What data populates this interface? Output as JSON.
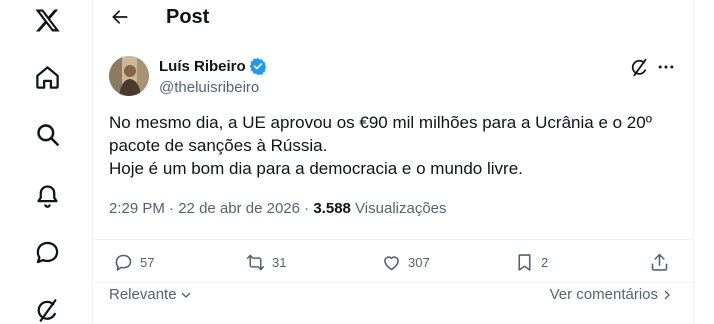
{
  "header": {
    "title": "Post"
  },
  "sidebar": {
    "items": [
      {
        "icon": "x-logo-icon"
      },
      {
        "icon": "home-icon"
      },
      {
        "icon": "search-icon"
      },
      {
        "icon": "notifications-bell-icon"
      },
      {
        "icon": "messages-icon"
      },
      {
        "icon": "grok-icon"
      }
    ]
  },
  "tweet": {
    "author_name": "Luís Ribeiro",
    "author_handle": "@theluisribeiro",
    "verified": true,
    "text_lines": [
      "No mesmo dia, a UE aprovou os €90 mil milhões para a Ucrânia e o 20º",
      "pacote de sanções à Rússia.",
      "Hoje é um bom dia para a democracia e o mundo livre."
    ],
    "time": "2:29 PM",
    "separator": "·",
    "date": "22 de abr de 2026",
    "views": "3.588",
    "views_label": "Visualizações",
    "stats": {
      "replies": "57",
      "reposts": "31",
      "likes": "307",
      "bookmarks": "2"
    }
  },
  "replies": {
    "sort_label": "Relevante",
    "see_comments_label": "Ver comentários"
  },
  "colors": {
    "text_primary": "#0f1419",
    "text_secondary": "#536471",
    "verified_blue": "#1d9bf0",
    "border": "#eff3f4"
  }
}
